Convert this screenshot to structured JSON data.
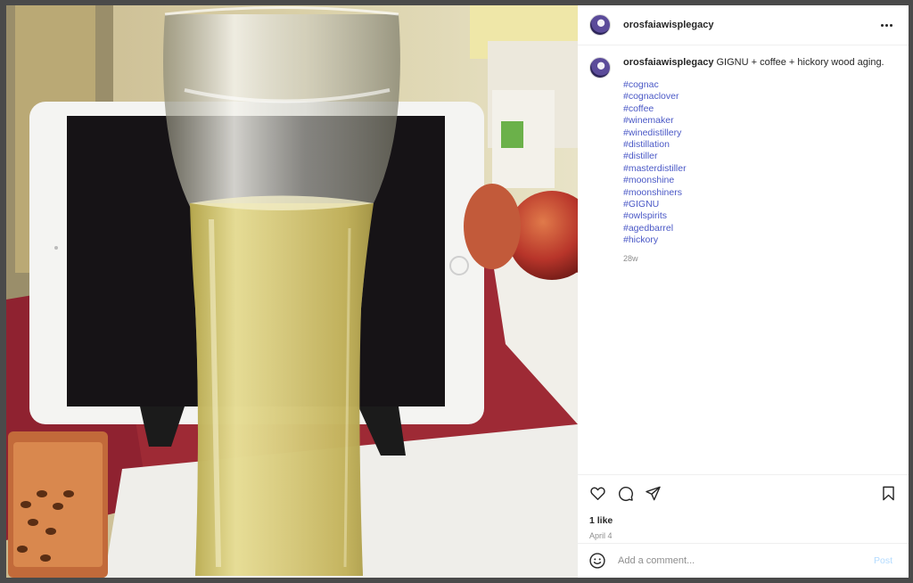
{
  "post": {
    "username": "orosfaiawisplegacy",
    "caption_username": "orosfaiawisplegacy",
    "caption_text": "GIGNU + coffee + hickory wood aging.",
    "hashtags": [
      "#cognac",
      "#cognaclover",
      "#coffee",
      "#winemaker",
      "#winedistillery",
      "#distillation",
      "#distiller",
      "#masterdistiller",
      "#moonshine",
      "#moonshiners",
      "#GIGNU",
      "#owlspirits",
      "#agedbarrel",
      "#hickory"
    ],
    "caption_age": "28w",
    "likes": "1 like",
    "date": "April 4"
  },
  "comment": {
    "placeholder": "Add a comment...",
    "post_label": "Post"
  },
  "icons": {
    "more": "more-icon",
    "like": "heart-icon",
    "comment": "comment-icon",
    "share": "send-icon",
    "save": "bookmark-icon",
    "emoji": "emoji-icon"
  },
  "colors": {
    "hashtag": "#4a58c6",
    "post_button": "#b3dbff",
    "muted_text": "#8e8e8e"
  }
}
